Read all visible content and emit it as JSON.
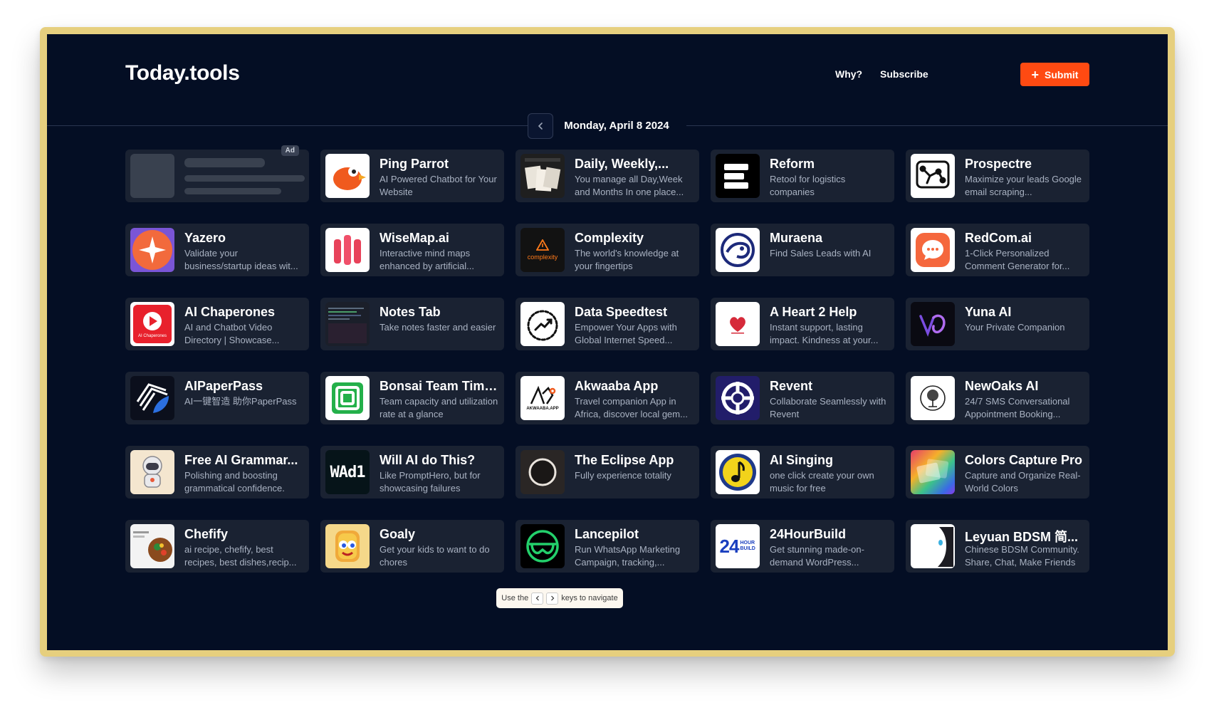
{
  "header": {
    "logo": "Today.tools",
    "nav": [
      "Why?",
      "Subscribe"
    ],
    "submit_label": "Submit"
  },
  "date_bar": {
    "date": "Monday, April 8 2024"
  },
  "ad": {
    "badge": "Ad"
  },
  "tools": [
    {
      "title": "Ping Parrot",
      "desc": "AI Powered Chatbot for Your Website",
      "icon": "parrot-icon"
    },
    {
      "title": "Daily, Weekly,...",
      "desc": "You manage all Day,Week and Months In one place...",
      "icon": "planner-icon"
    },
    {
      "title": "Reform",
      "desc": "Retool for logistics companies",
      "icon": "reform-logo-icon"
    },
    {
      "title": "Prospectre",
      "desc": "Maximize your leads Google email scraping...",
      "icon": "network-icon"
    },
    {
      "title": "Yazero",
      "desc": "Validate your business/startup ideas wit...",
      "icon": "compass-star-icon"
    },
    {
      "title": "WiseMap.ai",
      "desc": "Interactive mind maps enhanced by artificial...",
      "icon": "wisemap-logo-icon"
    },
    {
      "title": "Complexity",
      "desc": "The world's knowledge at your fingertips",
      "icon": "complexity-logo-icon",
      "icon_text": "complexity"
    },
    {
      "title": "Muraena",
      "desc": "Find Sales Leads with AI",
      "icon": "eel-icon"
    },
    {
      "title": "RedCom.ai",
      "desc": "1-Click Personalized Comment Generator for...",
      "icon": "chat-bubble-icon"
    },
    {
      "title": "AI Chaperones",
      "desc": "AI and Chatbot Video Directory | Showcase...",
      "icon": "play-button-icon",
      "icon_text": "AI Chaperones"
    },
    {
      "title": "Notes Tab",
      "desc": "Take notes faster and easier",
      "icon": "notes-icon"
    },
    {
      "title": "Data Speedtest",
      "desc": "Empower Your Apps with Global Internet Speed...",
      "icon": "speedometer-icon"
    },
    {
      "title": "A Heart 2 Help",
      "desc": "Instant support, lasting impact. Kindness at your...",
      "icon": "heart-icon"
    },
    {
      "title": "Yuna AI",
      "desc": "Your Private Companion",
      "icon": "yuna-logo-icon"
    },
    {
      "title": "AIPaperPass",
      "desc": "AI一键智造 助你PaperPass",
      "icon": "paperpass-logo-icon"
    },
    {
      "title": "Bonsai Team Time...",
      "desc": "Team capacity and utilization rate at a glance",
      "icon": "bonsai-logo-icon"
    },
    {
      "title": "Akwaaba App",
      "desc": "Travel companion App in Africa, discover local gem...",
      "icon": "akwaaba-logo-icon",
      "icon_text": "AKWAABA.APP"
    },
    {
      "title": "Revent",
      "desc": "Collaborate Seamlessly with Revent",
      "icon": "crosshair-icon"
    },
    {
      "title": "NewOaks AI",
      "desc": "24/7 SMS Conversational Appointment Booking...",
      "icon": "oak-tree-icon"
    },
    {
      "title": "Free AI Grammar...",
      "desc": "Polishing and boosting grammatical confidence.",
      "icon": "astronaut-icon"
    },
    {
      "title": "Will AI do This?",
      "desc": "Like PromptHero, but for showcasing failures",
      "icon": "wad-logo-icon",
      "icon_text": "WAd1"
    },
    {
      "title": "The Eclipse App",
      "desc": "Fully experience totality",
      "icon": "eclipse-icon"
    },
    {
      "title": "AI Singing",
      "desc": "one click create your own music for free",
      "icon": "music-note-icon"
    },
    {
      "title": "Colors Capture Pro",
      "desc": "Capture and Organize Real-World Colors",
      "icon": "colors-icon"
    },
    {
      "title": "Chefify",
      "desc": "ai recipe, chefify, best recipes, best dishes,recip...",
      "icon": "food-bowl-icon"
    },
    {
      "title": "Goaly",
      "desc": "Get your kids to want to do chores",
      "icon": "goaly-mascot-icon"
    },
    {
      "title": "Lancepilot",
      "desc": "Run WhatsApp Marketing Campaign, tracking,...",
      "icon": "lancepilot-logo-icon"
    },
    {
      "title": "24HourBuild",
      "desc": "Get stunning made-on-demand WordPress...",
      "icon": "24hour-logo-icon",
      "icon_text": "24",
      "icon_text2": "HOUR BUILD"
    },
    {
      "title": "Leyuan BDSM 简...",
      "desc": "Chinese BDSM Community. Share, Chat, Make Friends",
      "icon": "leyuan-logo-icon"
    }
  ],
  "footer_hint": {
    "before": "Use the",
    "after": "keys to navigate"
  },
  "colors": {
    "background": "#040e24",
    "card": "#1a2232",
    "accent": "#ff4a12",
    "frame": "#e6cf7e"
  }
}
